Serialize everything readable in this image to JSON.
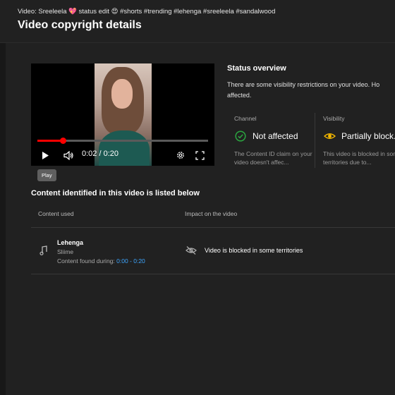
{
  "header": {
    "video_caption": "Video: Sreeleela 💖 status edit 😍 #shorts #trending #lehenga #sreeleela #sandalwood",
    "page_title": "Video copyright details"
  },
  "player": {
    "current_time": "0:02",
    "duration": "0:20",
    "time_display": "0:02 / 0:20",
    "progress_fraction": 0.15,
    "tooltip": "Play",
    "icons": [
      "play-icon",
      "volume-icon",
      "settings-icon",
      "fullscreen-icon"
    ]
  },
  "status": {
    "title": "Status overview",
    "text": "There are some visibility restrictions on your video. Ho affected.",
    "channel": {
      "label": "Channel",
      "value": "Not affected",
      "desc": "The Content ID claim on your video doesn't affec...",
      "icon": "check-circle-icon",
      "color": "#2ba640"
    },
    "visibility": {
      "label": "Visibility",
      "value": "Partially block...",
      "desc": "This video is blocked in some territories due to...",
      "icon": "eye-icon",
      "color": "#f2b600"
    }
  },
  "content": {
    "section_title": "Content identified in this video is listed below",
    "columns": [
      "Content used",
      "Impact on the video"
    ],
    "rows": [
      {
        "title": "Lehenga",
        "artist": "Sliime",
        "found_label": "Content found during:",
        "found_range": "0:00 - 0:20",
        "impact": "Video is blocked in some territories"
      }
    ]
  }
}
